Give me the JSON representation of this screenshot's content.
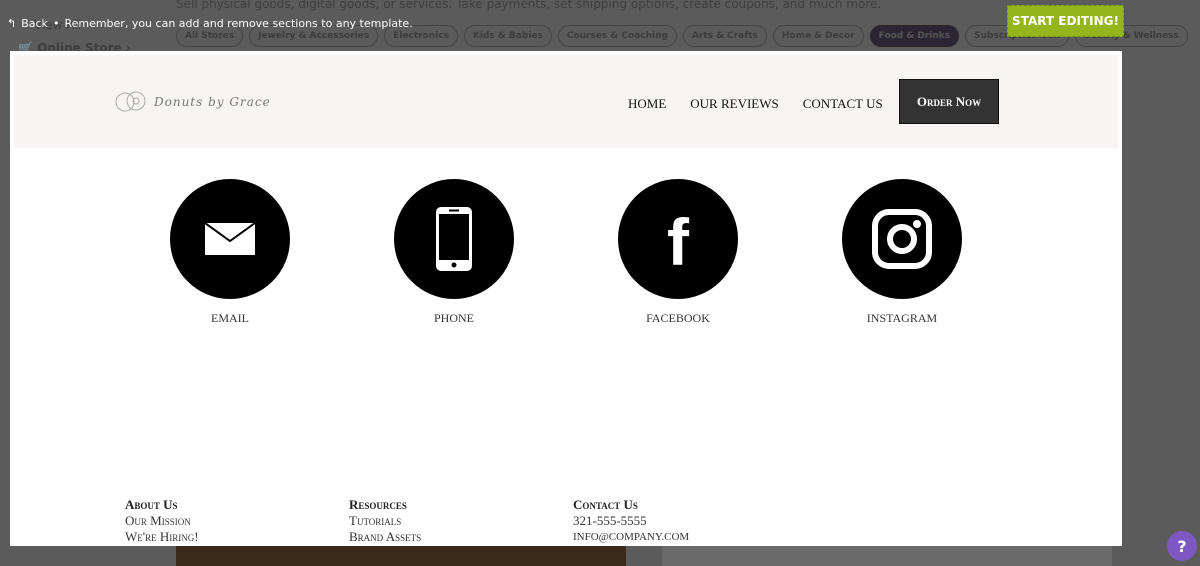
{
  "background": {
    "description_text": "Sell physical goods, digital goods, or services. Take payments, set shipping options, create coupons, and much more.",
    "view_all": "View All",
    "online_store": "Online Store",
    "categories": [
      "All Stores",
      "Jewelry & Accessories",
      "Electronics",
      "Kids & Babies",
      "Courses & Coaching",
      "Arts & Crafts",
      "Home & Decor",
      "Food & Drinks",
      "Subscription Box",
      "Beauty & Wellness"
    ],
    "active_category": "Food & Drinks"
  },
  "topbar": {
    "back": "Back",
    "tip": "Remember, you can add and remove sections to any template.",
    "start_editing": "START EDITING!"
  },
  "site": {
    "brand": "Donuts by Grace",
    "nav": [
      "HOME",
      "OUR REVIEWS",
      "CONTACT US"
    ],
    "order_button": "Order Now",
    "social": [
      {
        "label": "EMAIL",
        "icon": "envelope-icon"
      },
      {
        "label": "PHONE",
        "icon": "phone-icon"
      },
      {
        "label": "FACEBOOK",
        "icon": "facebook-icon"
      },
      {
        "label": "INSTAGRAM",
        "icon": "instagram-icon"
      }
    ],
    "footer": [
      {
        "heading": "About Us",
        "links": [
          "Our Mission",
          "We're Hiring!"
        ]
      },
      {
        "heading": "Resources",
        "links": [
          "Tutorials",
          "Brand Assets"
        ]
      },
      {
        "heading": "Contact Us",
        "links": [
          "321-555-5555",
          "info@company.com"
        ]
      }
    ]
  },
  "help": "?",
  "colors": {
    "accent": "#94b51c",
    "header_bg": "#f9f4f4",
    "overlay": "#5b5b5b",
    "help": "#7e57c2"
  }
}
